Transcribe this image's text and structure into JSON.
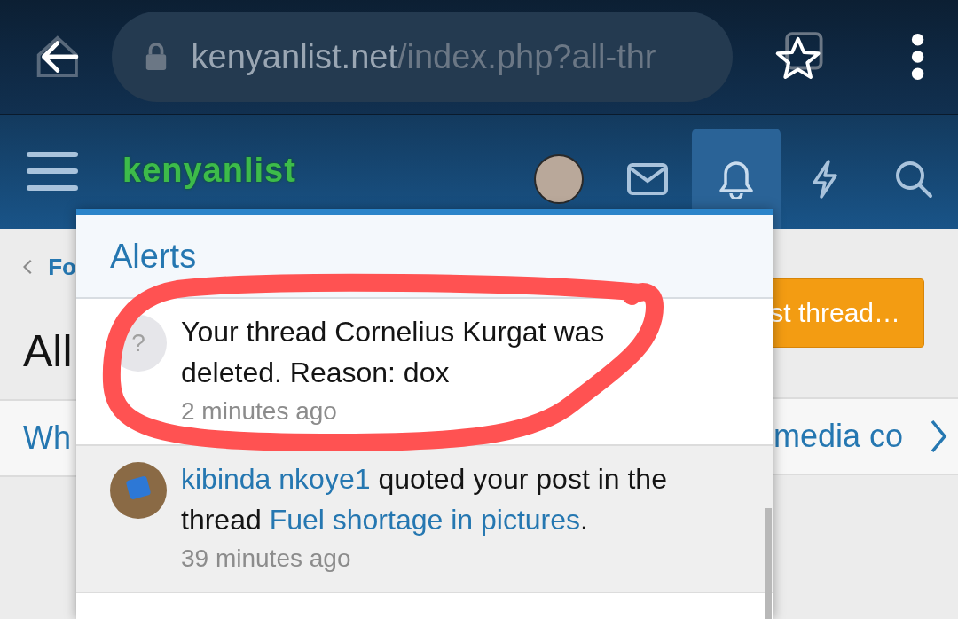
{
  "browser": {
    "url_domain": "kenyanlist.net",
    "url_path": "/index.php?all-thr"
  },
  "site_header": {
    "logo": "kenyanlist",
    "nav": [
      {
        "kind": "avatar",
        "selected": false
      },
      {
        "kind": "inbox",
        "selected": false
      },
      {
        "kind": "alerts",
        "selected": true
      },
      {
        "kind": "whats-new",
        "selected": false
      },
      {
        "kind": "search",
        "selected": false
      }
    ]
  },
  "page": {
    "breadcrumb": "Fo",
    "title": "All",
    "post_button": "st thread…",
    "tab_left": "Wh",
    "tab_right": "media co"
  },
  "alerts_popup": {
    "title": "Alerts",
    "items": [
      {
        "kind": "system",
        "unread": false,
        "icon_text": "?",
        "parts": [
          {
            "text": "Your thread Cornelius Kurgat was deleted. Reason: dox",
            "link": false
          }
        ],
        "time": "2 minutes ago"
      },
      {
        "kind": "user",
        "unread": true,
        "parts": [
          {
            "text": "kibinda nkoye1",
            "link": true
          },
          {
            "text": " quoted your post in the thread ",
            "link": false
          },
          {
            "text": "Fuel shortage in pictures",
            "link": true
          },
          {
            "text": ".",
            "link": false
          }
        ],
        "time": "39 minutes ago"
      }
    ]
  },
  "annotation": {
    "kind": "scribble-circle",
    "color": "#ff5252"
  }
}
